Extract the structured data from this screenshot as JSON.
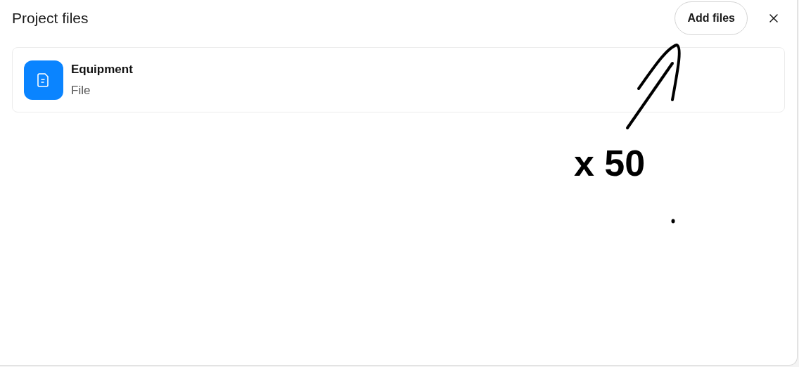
{
  "dialog": {
    "title": "Project files",
    "add_button": "Add files"
  },
  "files": [
    {
      "name": "Equipment",
      "type": "File"
    }
  ],
  "annotation": {
    "text": "x 50"
  }
}
